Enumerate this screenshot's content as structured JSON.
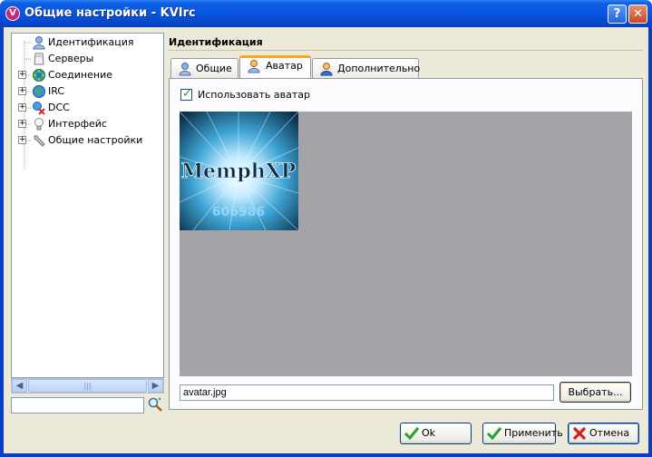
{
  "window": {
    "title": "Общие настройки - KVIrc",
    "app_icon_letter": "V",
    "help_label": "?",
    "close_label": "✕"
  },
  "tree": {
    "items": [
      {
        "label": "Идентификация",
        "icon": "user-icon",
        "expandable": false,
        "selected": true
      },
      {
        "label": "Серверы",
        "icon": "server-icon",
        "expandable": false,
        "selected": false
      },
      {
        "label": "Соединение",
        "icon": "connection-icon",
        "expandable": true,
        "selected": false
      },
      {
        "label": "IRC",
        "icon": "irc-globe-icon",
        "expandable": true,
        "selected": false
      },
      {
        "label": "DCC",
        "icon": "dcc-icon",
        "expandable": true,
        "selected": false
      },
      {
        "label": "Интерфейс",
        "icon": "lightbulb-icon",
        "expandable": true,
        "selected": false
      },
      {
        "label": "Общие настройки",
        "icon": "wrench-icon",
        "expandable": true,
        "selected": false
      }
    ],
    "search_value": ""
  },
  "section": {
    "title": "Идентификация"
  },
  "tabs": [
    {
      "label": "Общие",
      "icon": "user-icon",
      "active": false
    },
    {
      "label": "Аватар",
      "icon": "avatar-user-icon",
      "active": true
    },
    {
      "label": "Дополнительно",
      "icon": "info-user-icon",
      "active": false
    }
  ],
  "avatar": {
    "use_avatar_label": "Использовать аватар",
    "use_avatar_checked": true,
    "image_text": "MemphXP",
    "image_number": "606986",
    "file_value": "avatar.jpg",
    "choose_label": "Выбрать..."
  },
  "buttons": {
    "ok_label": "Ok",
    "apply_label": "Применить",
    "cancel_label": "Отмена"
  },
  "colors": {
    "title_bar": "#0a55de",
    "client_bg": "#ece9d8",
    "avatar_bg": "#a4a4a8",
    "active_tab_accent": "#f4a827"
  }
}
